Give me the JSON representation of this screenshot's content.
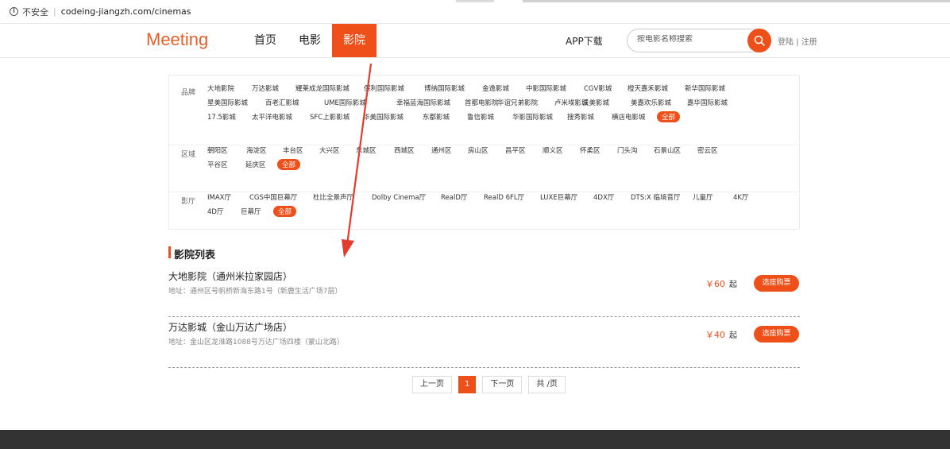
{
  "browser": {
    "security_label": "不安全",
    "url": "codeing-jiangzh.com/cinemas"
  },
  "header": {
    "logo": "Meeting",
    "nav": [
      {
        "label": "首页",
        "active": false
      },
      {
        "label": "电影",
        "active": false
      },
      {
        "label": "影院",
        "active": true
      }
    ],
    "app_download": "APP下载",
    "search_placeholder": "按电影名称搜索",
    "login": "登陆",
    "divider": "|",
    "register": "注册"
  },
  "filters": {
    "brand": {
      "label": "品牌",
      "options": [
        "大地影院",
        "万达影城",
        "耀莱成龙国际影城",
        "保利国际影城",
        "博纳国际影城",
        "金逸影城",
        "中影国际影城",
        "CGV影城",
        "橙天嘉禾影城",
        "新华国际影城",
        "星美国际影城",
        "百老汇影城",
        "UME国际影城",
        "幸福蓝海国际影城",
        "首都电影院",
        "华谊兄弟影院",
        "卢米埃影城",
        "沃美影城",
        "美嘉欢乐影城",
        "嘉华国际影城",
        "17.5影城",
        "太平洋电影城",
        "SFC上影影城",
        "华美国际影城",
        "东都影城",
        "鲁信影城",
        "华影国际影城",
        "搜秀影城",
        "横店电影城",
        "全部"
      ]
    },
    "district": {
      "label": "区域",
      "options": [
        "朝阳区",
        "海淀区",
        "丰台区",
        "大兴区",
        "东城区",
        "西城区",
        "通州区",
        "房山区",
        "昌平区",
        "顺义区",
        "怀柔区",
        "门头沟",
        "石景山区",
        "密云区",
        "平谷区",
        "延庆区",
        "全部"
      ]
    },
    "hall": {
      "label": "影厅",
      "options": [
        "IMAX厅",
        "CGS中国巨幕厅",
        "杜比全景声厅",
        "Dolby Cinema厅",
        "RealD厅",
        "RealD 6FL厅",
        "LUXE巨幕厅",
        "4DX厅",
        "DTS:X 临境音厅",
        "儿童厅",
        "4K厅",
        "4D厅",
        "巨幕厅",
        "全部"
      ]
    }
  },
  "list": {
    "title": "影院列表",
    "cinemas": [
      {
        "name": "大地影院（通州米拉家园店）",
        "address": "地址：通州区号帆桥新海东路1号（新鹿生活广场7层）",
        "price": "￥60",
        "from": "起",
        "button": "选座购票"
      },
      {
        "name": "万达影城（金山万达广场店）",
        "address": "地址：金山区龙淮路1088号万达广场四楼（蒙山北路）",
        "price": "￥40",
        "from": "起",
        "button": "选座购票"
      }
    ]
  },
  "pagination": {
    "prev": "上一页",
    "current": "1",
    "next": "下一页",
    "total": "共 /页"
  },
  "colors": {
    "accent": "#ef4f19",
    "logo": "#e2622a",
    "annotation_arrow": "#e33b2e",
    "footer": "#333333"
  }
}
